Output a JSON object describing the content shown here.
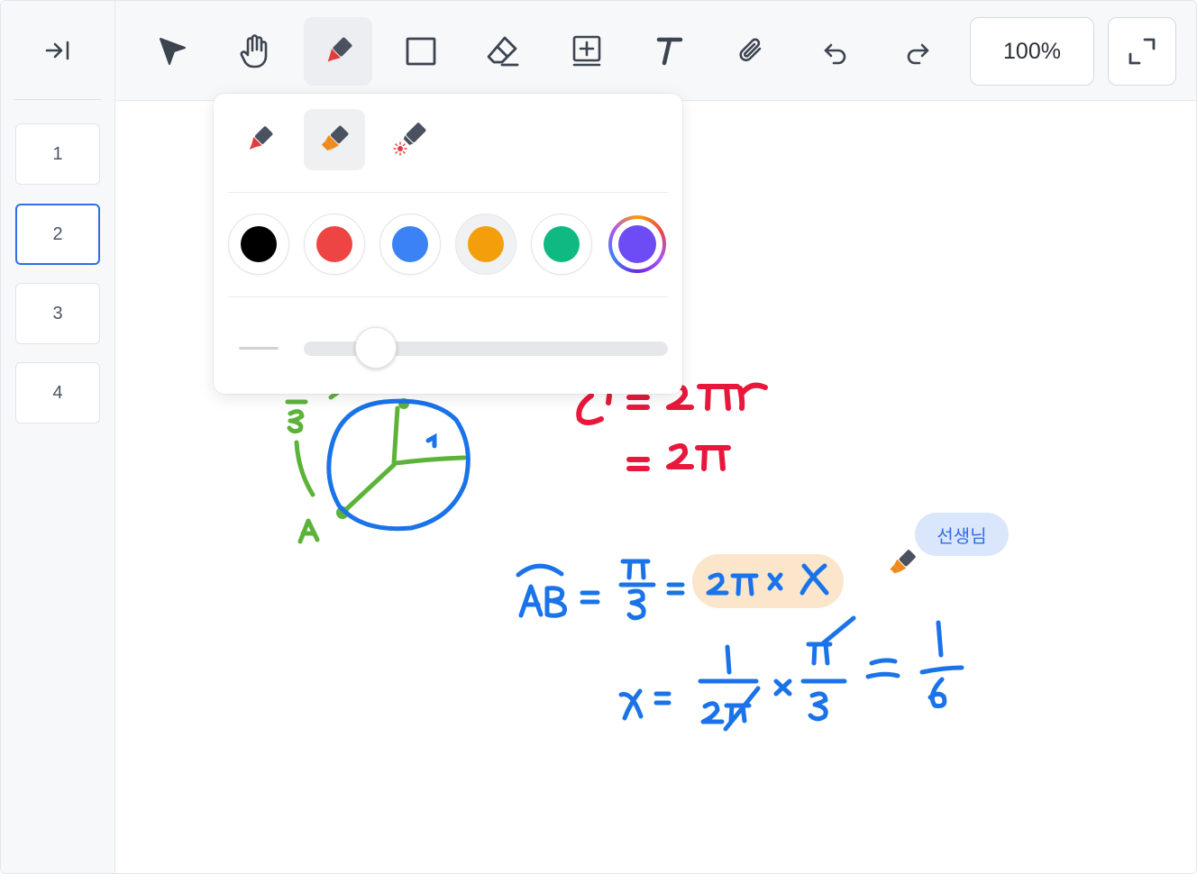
{
  "sidebar": {
    "collapse_icon": "collapse-right-icon",
    "pages": [
      {
        "label": "1",
        "active": false
      },
      {
        "label": "2",
        "active": true
      },
      {
        "label": "3",
        "active": false
      },
      {
        "label": "4",
        "active": false
      }
    ]
  },
  "toolbar": {
    "tools": [
      "select-arrow-icon",
      "hand-pan-icon",
      "pen-icon",
      "rectangle-icon",
      "eraser-icon",
      "add-frame-icon",
      "text-icon",
      "attach-paperclip-icon",
      "undo-icon",
      "redo-icon"
    ],
    "active_tool": "pen-icon",
    "zoom_label": "100%",
    "fullscreen_icon": "fullscreen-icon"
  },
  "pen_popover": {
    "pen_types": [
      "pen",
      "highlighter",
      "laser-pointer"
    ],
    "active_pen_type": "highlighter",
    "colors": [
      "#000000",
      "#ef4444",
      "#3b82f6",
      "#f59e0b",
      "#10b981",
      "#6d4bf5"
    ],
    "selected_color": "#f59e0b",
    "stroke_width_fraction": 0.16
  },
  "collaborator": {
    "name": "선생님",
    "cursor_color": "#f08a1c",
    "badge_color": "#d9e6fb"
  },
  "accent": "#2f6fe4"
}
